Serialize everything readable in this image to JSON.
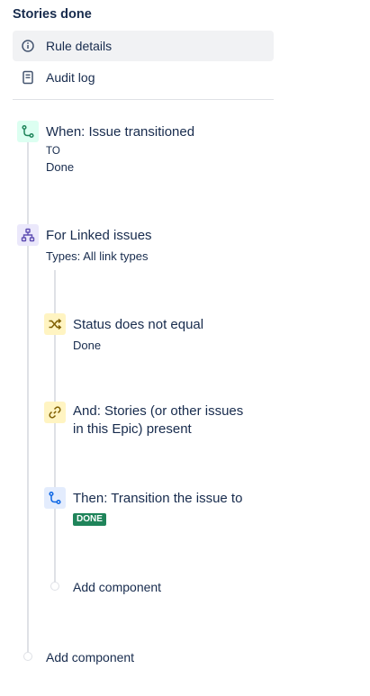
{
  "rule": {
    "title": "Stories done"
  },
  "nav": {
    "items": [
      {
        "label": "Rule details",
        "icon": "info-icon",
        "selected": true
      },
      {
        "label": "Audit log",
        "icon": "audit-log-icon",
        "selected": false
      }
    ]
  },
  "components": {
    "trigger": {
      "title": "When: Issue transitioned",
      "to_label": "TO",
      "to_value": "Done",
      "icon": "branch-trigger-icon",
      "color": "#1f845a"
    },
    "branch": {
      "title": "For Linked issues",
      "subtitle": "Types: All link types",
      "icon": "hierarchy-icon",
      "color": "#5e4db2"
    },
    "condition_status": {
      "title": "Status does not equal",
      "subtitle": "Done",
      "icon": "shuffle-icon",
      "color": "#7f5f01"
    },
    "condition_present_lines": [
      "And: Stories (or other issues",
      "in this Epic) present"
    ],
    "condition_present_icon": "link-icon",
    "action": {
      "title": "Then: Transition the issue to",
      "status": "DONE",
      "icon": "transition-icon",
      "color": "#0c66e4"
    },
    "add_inner": {
      "label": "Add component"
    },
    "add_outer": {
      "label": "Add component"
    }
  },
  "colors": {
    "status_done": "#1f845a",
    "selected_bg": "#f1f2f4",
    "connector": "#dfe1e6"
  }
}
